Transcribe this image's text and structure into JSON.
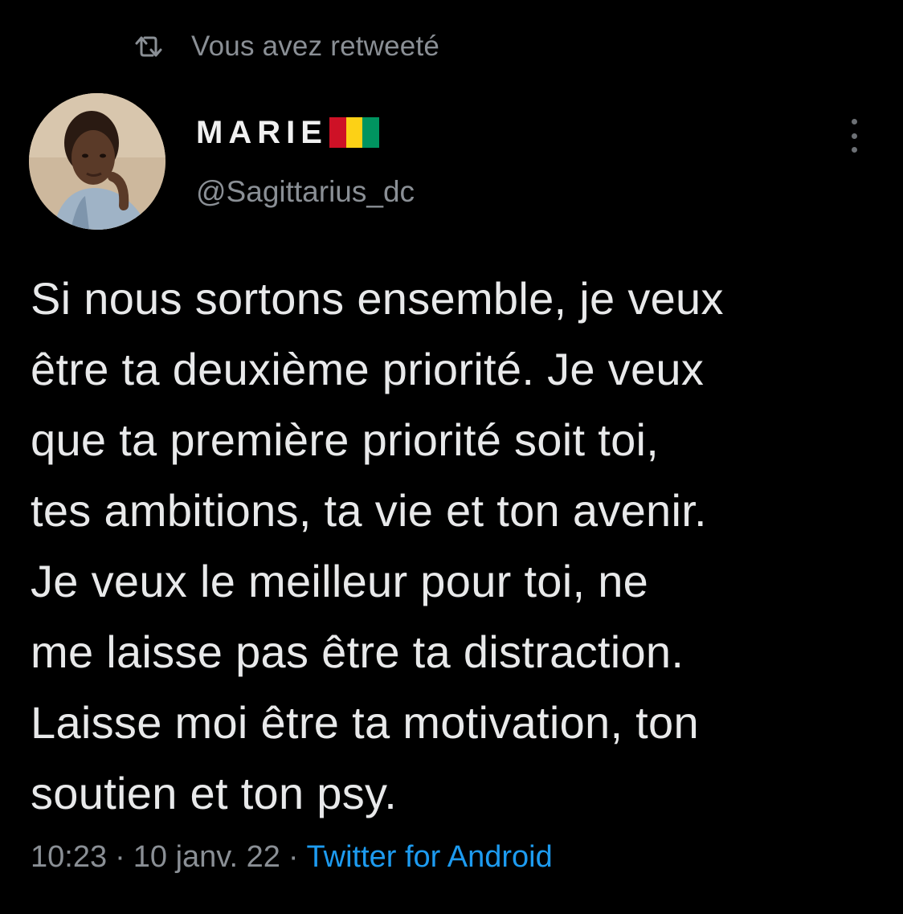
{
  "retweet": {
    "icon": "retweet-icon",
    "label": "Vous avez retweeté"
  },
  "author": {
    "display_name": "MARIE",
    "flag_colors": [
      "#ce1126",
      "#fcd116",
      "#009460"
    ],
    "handle": "@Sagittarius_dc"
  },
  "tweet": {
    "lines": [
      "Si nous sortons ensemble, je veux",
      "être ta deuxième priorité. Je veux",
      "que ta première priorité soit toi,",
      "tes ambitions, ta vie et ton avenir.",
      "Je veux le meilleur pour toi, ne",
      "me laisse pas être ta distraction.",
      "Laisse moi être ta motivation, ton",
      "soutien et ton psy."
    ]
  },
  "meta": {
    "time": "10:23",
    "separator": "·",
    "date": "10 janv. 22",
    "source": "Twitter for Android"
  },
  "colors": {
    "background": "#000000",
    "text": "#e8e9ea",
    "secondary": "#8a8f95",
    "link": "#1d9bf0"
  }
}
